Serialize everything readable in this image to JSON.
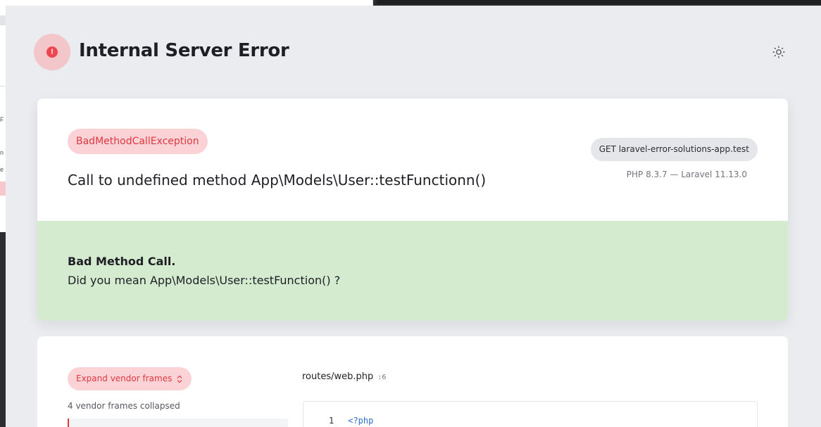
{
  "header": {
    "title": "Internal Server Error",
    "error_icon": "alert-icon",
    "theme_icon": "sun-icon"
  },
  "exception": {
    "class": "BadMethodCallException",
    "message": "Call to undefined method App\\Models\\User::testFunctionn()",
    "request": "GET laravel-error-solutions-app.test",
    "versions": "PHP 8.3.7 — Laravel 11.13.0"
  },
  "solution": {
    "title": "Bad Method Call.",
    "text": "Did you mean App\\Models\\User::testFunction() ?"
  },
  "trace": {
    "expand_label": "Expand vendor frames",
    "expand_icon": "chevron-up-down-icon",
    "collapsed_note": "4 vendor frames collapsed",
    "file_path": "routes/web.php",
    "file_line": ":6",
    "code_lines": [
      {
        "number": "1",
        "text": "<?php"
      }
    ]
  },
  "background": {
    "letters": [
      "F",
      "n",
      "e"
    ]
  },
  "colors": {
    "error_red": "#ef4550",
    "badge_bg": "#fbd3d6",
    "solution_bg": "#d5ebd0",
    "page_bg": "#eaecef"
  }
}
